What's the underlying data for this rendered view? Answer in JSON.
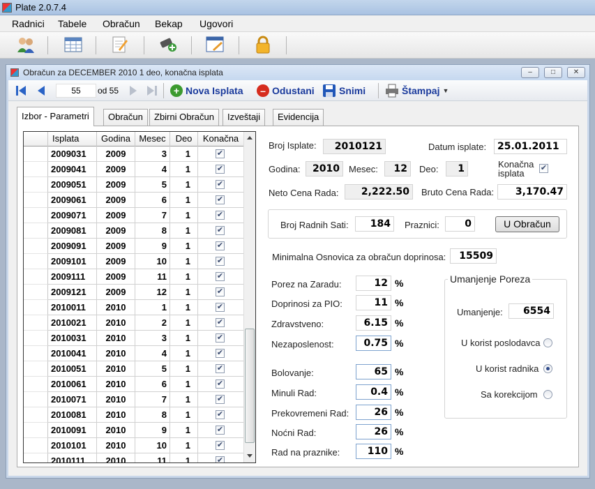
{
  "app": {
    "title": "Plate 2.0.7.4"
  },
  "menu": [
    "Radnici",
    "Tabele",
    "Obračun",
    "Bekap",
    "Ugovori"
  ],
  "toolbar_icons": [
    "users-icon",
    "table-icon",
    "edit-document-icon",
    "add-usb-icon",
    "window-edit-icon",
    "lock-icon"
  ],
  "child_window": {
    "title": "Obračun za DECEMBER 2010 1 deo, konačna isplata",
    "buttons": {
      "minimize": "‒",
      "restore": "□",
      "close": "✕"
    }
  },
  "navigator": {
    "position": "55",
    "of": "od 55",
    "nova_isplata": "Nova Isplata",
    "odustani": "Odustani",
    "snimi": "Snimi",
    "stampaj": "Štampaj"
  },
  "tabs": [
    "Izbor - Parametri",
    "Obračun",
    "Zbirni Obračun",
    "Izveštaji",
    "Evidencija"
  ],
  "active_tab": "Izbor - Parametri",
  "grid": {
    "columns": [
      "Isplata",
      "Godina",
      "Mesec",
      "Deo",
      "Konačna"
    ],
    "rows": [
      [
        "2009031",
        "2009",
        "3",
        "1",
        true
      ],
      [
        "2009041",
        "2009",
        "4",
        "1",
        true
      ],
      [
        "2009051",
        "2009",
        "5",
        "1",
        true
      ],
      [
        "2009061",
        "2009",
        "6",
        "1",
        true
      ],
      [
        "2009071",
        "2009",
        "7",
        "1",
        true
      ],
      [
        "2009081",
        "2009",
        "8",
        "1",
        true
      ],
      [
        "2009091",
        "2009",
        "9",
        "1",
        true
      ],
      [
        "2009101",
        "2009",
        "10",
        "1",
        true
      ],
      [
        "2009111",
        "2009",
        "11",
        "1",
        true
      ],
      [
        "2009121",
        "2009",
        "12",
        "1",
        true
      ],
      [
        "2010011",
        "2010",
        "1",
        "1",
        true
      ],
      [
        "2010021",
        "2010",
        "2",
        "1",
        true
      ],
      [
        "2010031",
        "2010",
        "3",
        "1",
        true
      ],
      [
        "2010041",
        "2010",
        "4",
        "1",
        true
      ],
      [
        "2010051",
        "2010",
        "5",
        "1",
        true
      ],
      [
        "2010061",
        "2010",
        "6",
        "1",
        true
      ],
      [
        "2010071",
        "2010",
        "7",
        "1",
        true
      ],
      [
        "2010081",
        "2010",
        "8",
        "1",
        true
      ],
      [
        "2010091",
        "2010",
        "9",
        "1",
        true
      ],
      [
        "2010101",
        "2010",
        "10",
        "1",
        true
      ],
      [
        "2010111",
        "2010",
        "11",
        "1",
        true
      ]
    ]
  },
  "form": {
    "broj_isplate_label": "Broj Isplate:",
    "broj_isplate": "2010121",
    "datum_isplate_label": "Datum isplate:",
    "datum_isplate": "25.01.2011",
    "godina_label": "Godina:",
    "godina": "2010",
    "mesec_label": "Mesec:",
    "mesec": "12",
    "deo_label": "Deo:",
    "deo": "1",
    "konacna_label_1": "Konačna",
    "konacna_label_2": "isplata",
    "neto_label": "Neto Cena Rada:",
    "neto": "2,222.50",
    "bruto_label": "Bruto Cena Rada:",
    "bruto": "3,170.47",
    "broj_sati_label": "Broj Radnih Sati:",
    "broj_sati": "184",
    "praznici_label": "Praznici:",
    "praznici": "0",
    "u_obracun_button": "U Obračun",
    "min_osnovica_label": "Minimalna Osnovica za obračun doprinosa:",
    "min_osnovica": "15509",
    "pct_symbol": "%",
    "rates": [
      {
        "label": "Porez na Zaradu:",
        "value": "12"
      },
      {
        "label": "Doprinosi za PIO:",
        "value": "11"
      },
      {
        "label": "Zdravstveno:",
        "value": "6.15"
      },
      {
        "label": "Nezaposlenost:",
        "value": "0.75"
      },
      {
        "label": "Bolovanje:",
        "value": "65"
      },
      {
        "label": "Minuli Rad:",
        "value": "0.4"
      },
      {
        "label": "Prekovremeni Rad:",
        "value": "26"
      },
      {
        "label": "Noćni Rad:",
        "value": "26"
      },
      {
        "label": "Rad na praznike:",
        "value": "110"
      }
    ]
  },
  "umanjenje": {
    "group_title": "Umanjenje Poreza",
    "label": "Umanjenje:",
    "value": "6554",
    "options": [
      {
        "label": "U korist poslodavca",
        "selected": false
      },
      {
        "label": "U korist radnika",
        "selected": true
      },
      {
        "label": "Sa korekcijom",
        "selected": false
      }
    ]
  }
}
